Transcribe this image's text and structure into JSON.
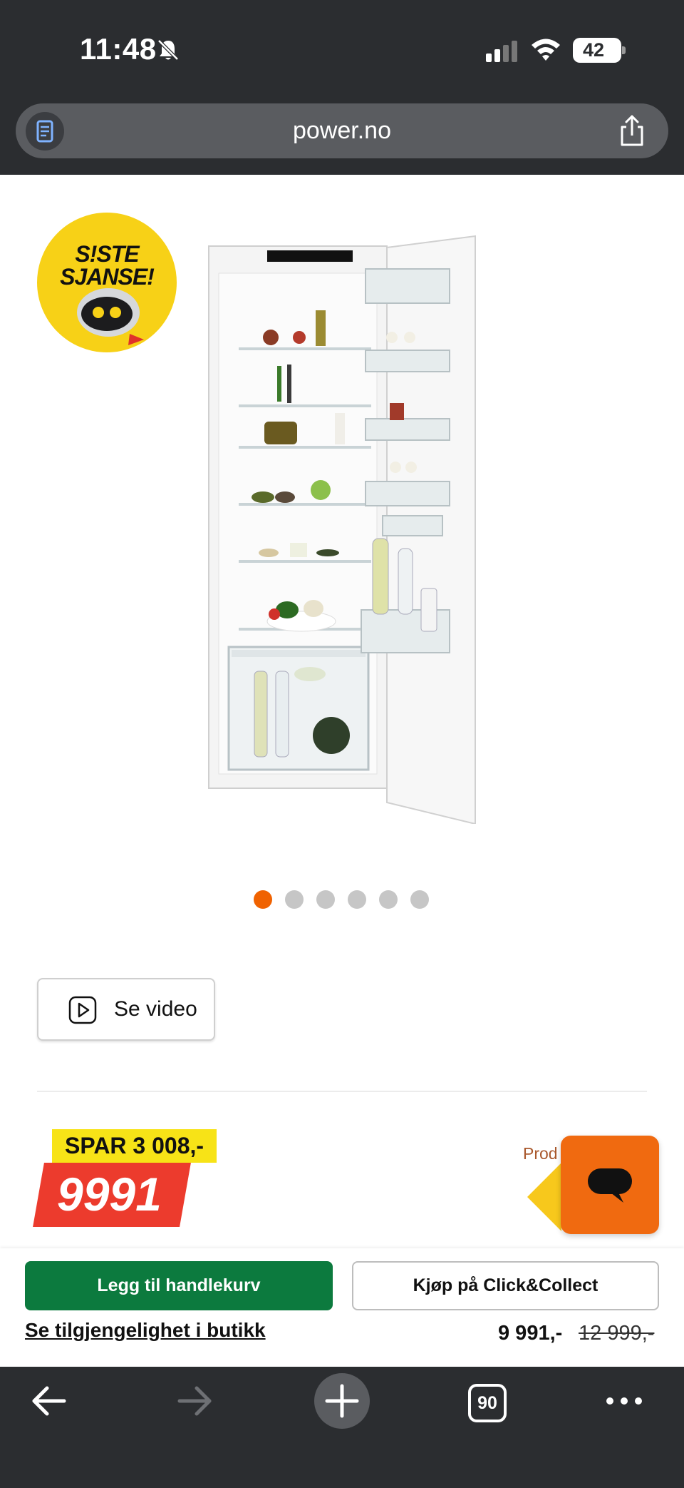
{
  "status_bar": {
    "time": "11:48",
    "battery": "42"
  },
  "browser": {
    "url": "power.no",
    "tab_count": "90"
  },
  "badge": {
    "line1": "S!STE",
    "line2": "SJANSE!"
  },
  "gallery": {
    "total_images": 6,
    "active_index": 0
  },
  "video_button": {
    "label": "Se video"
  },
  "price": {
    "spar_label": "SPAR 3 008,-",
    "big_price": "9991",
    "prod_partial": "Prod"
  },
  "purchase_bar": {
    "add_to_cart": "Legg til handlekurv",
    "click_collect": "Kjøp på Click&Collect",
    "availability_link": "Se tilgjengelighet i butikk",
    "current_price": "9 991,-",
    "old_price": "12 999,-"
  },
  "colors": {
    "accent_orange": "#f06200",
    "cart_green": "#0c7a3e",
    "sale_red": "#ec3b2d",
    "sale_yellow": "#f7e317",
    "chrome_dark": "#2b2d30"
  }
}
